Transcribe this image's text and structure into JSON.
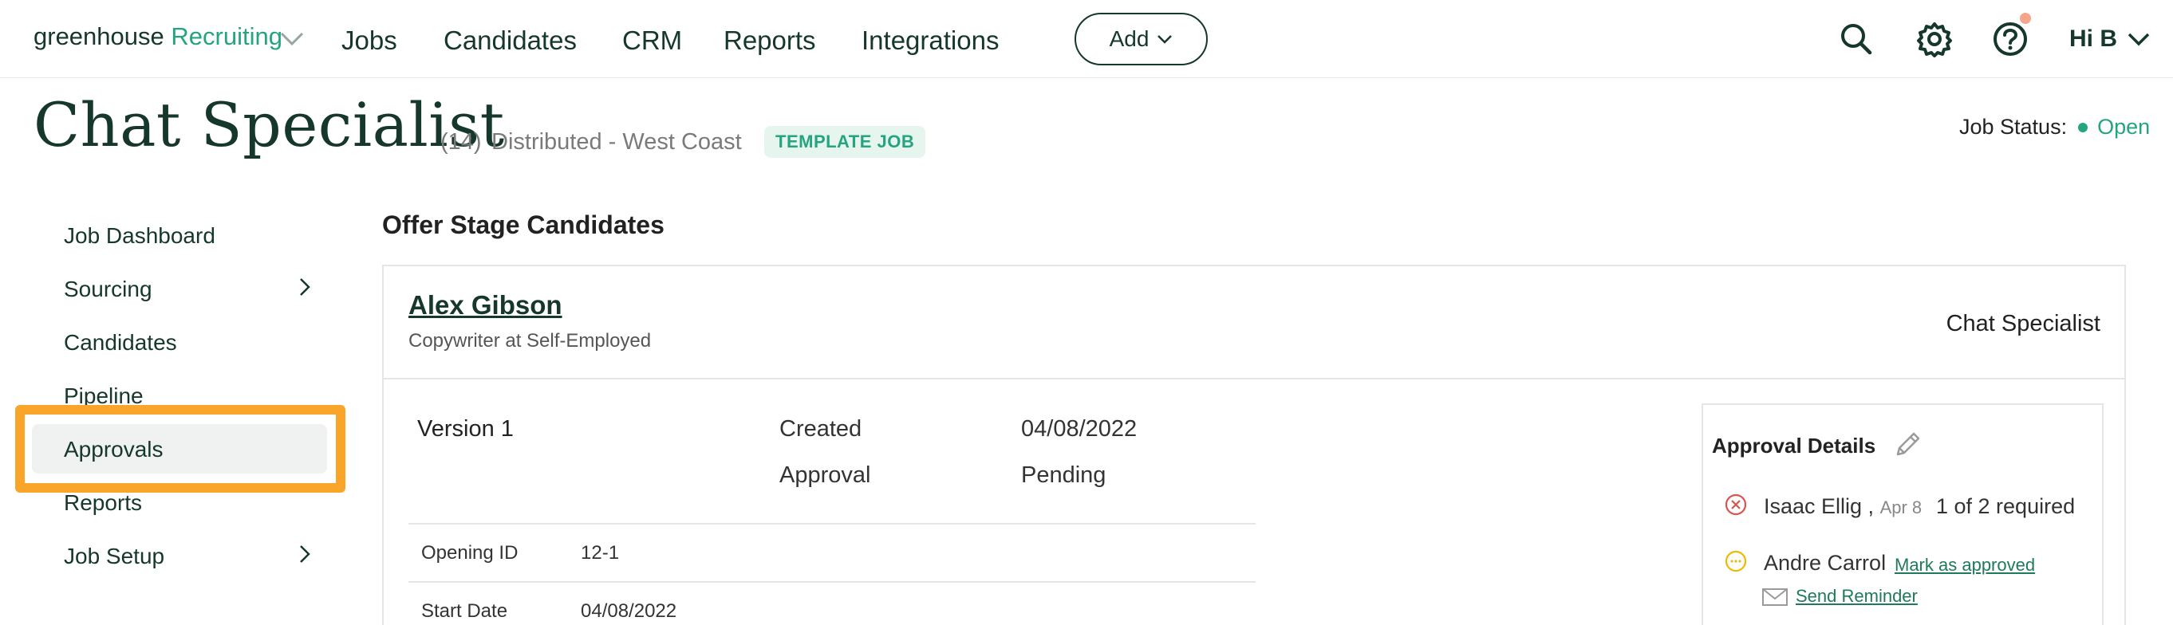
{
  "nav": {
    "logo_brand": "greenhouse",
    "logo_product": "Recruiting",
    "items": [
      "Jobs",
      "Candidates",
      "CRM",
      "Reports",
      "Integrations"
    ],
    "add_label": "Add",
    "user_label": "Hi B"
  },
  "header": {
    "title": "Chat Specialist",
    "count": "(14)",
    "location": "Distributed - West Coast",
    "badge": "TEMPLATE JOB",
    "status_label": "Job Status:",
    "status_value": "Open"
  },
  "sidebar": {
    "items": [
      {
        "label": "Job Dashboard"
      },
      {
        "label": "Sourcing"
      },
      {
        "label": "Candidates"
      },
      {
        "label": "Pipeline"
      },
      {
        "label": "Approvals"
      },
      {
        "label": "Reports"
      },
      {
        "label": "Job Setup"
      }
    ]
  },
  "main": {
    "section_title": "Offer Stage Candidates",
    "candidate": {
      "name": "Alex Gibson",
      "subtitle": "Copywriter at Self-Employed",
      "job": "Chat Specialist"
    },
    "offer": {
      "version": "Version 1",
      "created_label": "Created",
      "created_value": "04/08/2022",
      "approval_label": "Approval",
      "approval_value": "Pending",
      "rows": [
        {
          "label": "Opening ID",
          "value": "12-1"
        },
        {
          "label": "Start Date",
          "value": "04/08/2022"
        }
      ]
    },
    "approval_details": {
      "title": "Approval Details",
      "approvers": [
        {
          "name": "Isaac Ellig ,",
          "date": "Apr 8",
          "required": "1 of 2 required"
        },
        {
          "name": "Andre Carrol",
          "action": "Mark as approved",
          "reminder": "Send Reminder"
        }
      ]
    }
  },
  "colors": {
    "brand_dark": "#15372c",
    "brand_green": "#24a47f",
    "highlight": "#f9a52a",
    "rejected": "#d9534f",
    "pending": "#f2b705"
  }
}
